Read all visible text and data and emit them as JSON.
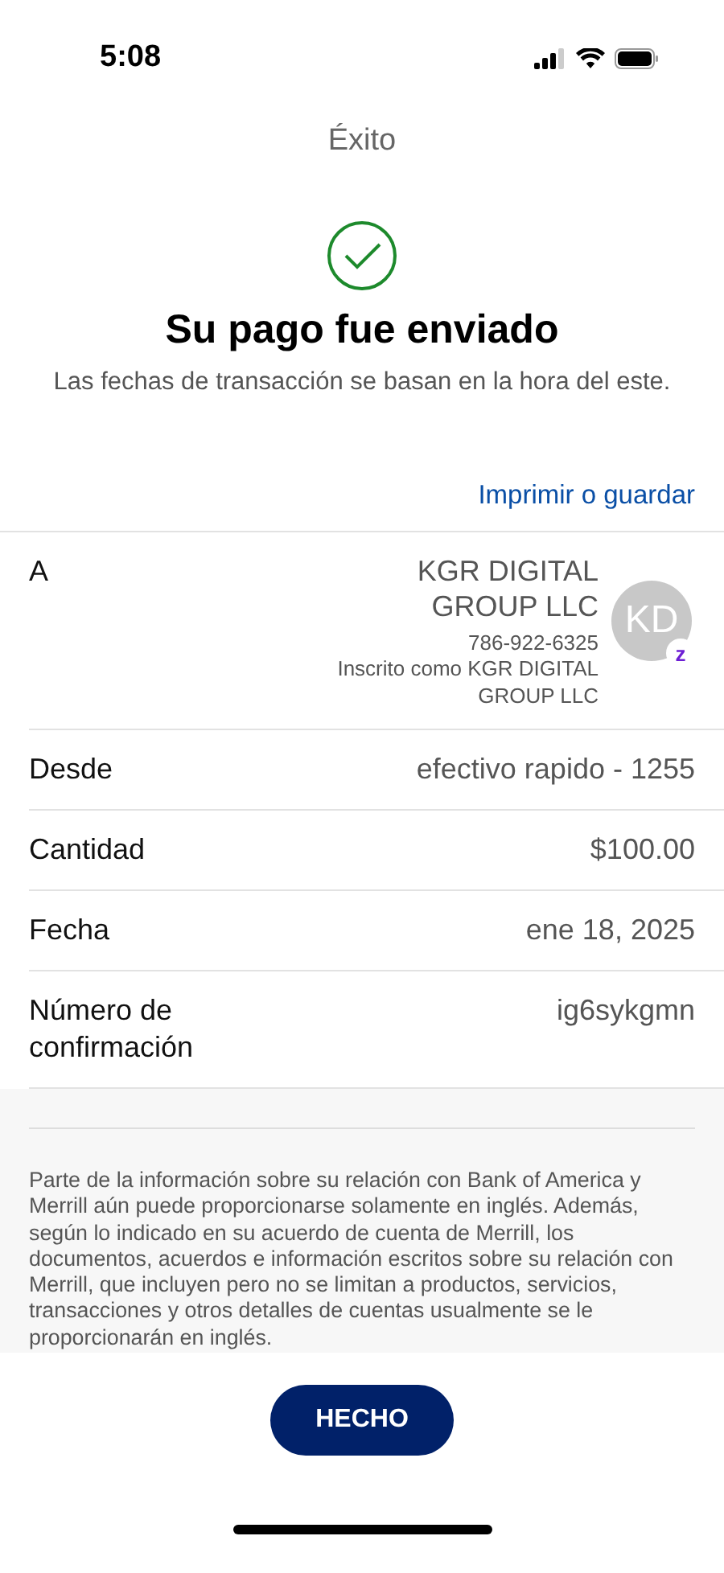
{
  "status_bar": {
    "time": "5:08"
  },
  "header": {
    "title": "Éxito"
  },
  "result": {
    "heading": "Su pago fue enviado",
    "subtitle": "Las fechas de transacción se basan en la hora del este."
  },
  "print_link": "Imprimir o guardar",
  "details": [
    {
      "kind": "recipient",
      "label": "A",
      "name": "KGR DIGITAL GROUP LLC",
      "phone": "786-922-6325",
      "enrolled": "Inscrito como KGR DIGITAL GROUP LLC",
      "initials": "KD",
      "badge": "z"
    },
    {
      "kind": "detail",
      "label": "Desde",
      "value": "efectivo rapido - 1255"
    },
    {
      "kind": "detail",
      "label": "Cantidad",
      "value": "$100.00"
    },
    {
      "kind": "detail",
      "label": "Fecha",
      "value": "ene 18, 2025"
    },
    {
      "kind": "detail",
      "label": "Número de confirmación",
      "value": "ig6sykgmn"
    }
  ],
  "disclaimer": "Parte de la información sobre su relación con Bank of America y Merrill aún puede proporcionarse solamente en inglés. Además, según lo indicado en su acuerdo de cuenta de Merrill, los documentos, acuerdos e información escritos sobre su relación con Merrill, que incluyen pero no se limitan a productos, servicios, transacciones y otros detalles de cuentas usualmente se le proporcionarán en inglés.",
  "done_button": "HECHO"
}
